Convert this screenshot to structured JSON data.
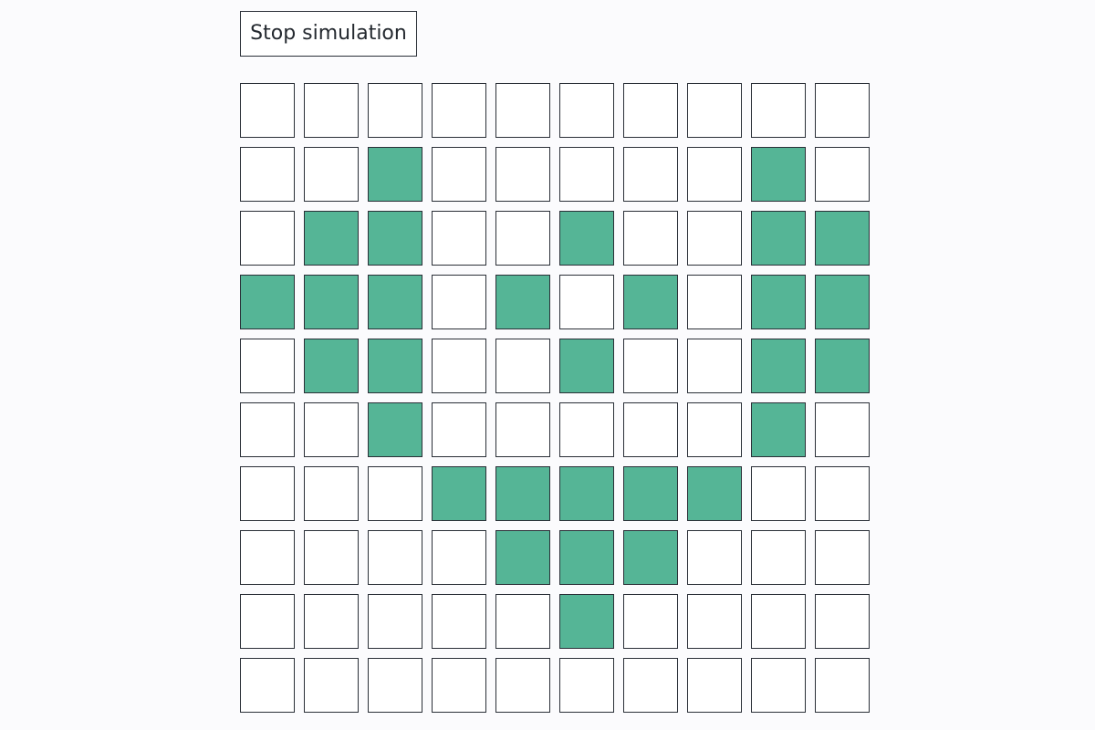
{
  "controls": {
    "stop_label": "Stop simulation"
  },
  "colors": {
    "alive": "#55b596",
    "dead": "#ffffff",
    "border": "#2a2f37"
  },
  "grid": {
    "rows": 10,
    "cols": 10,
    "cells": [
      [
        0,
        0,
        0,
        0,
        0,
        0,
        0,
        0,
        0,
        0
      ],
      [
        0,
        0,
        1,
        0,
        0,
        0,
        0,
        0,
        1,
        0
      ],
      [
        0,
        1,
        1,
        0,
        0,
        1,
        0,
        0,
        1,
        1
      ],
      [
        1,
        1,
        1,
        0,
        1,
        0,
        1,
        0,
        1,
        1
      ],
      [
        0,
        1,
        1,
        0,
        0,
        1,
        0,
        0,
        1,
        1
      ],
      [
        0,
        0,
        1,
        0,
        0,
        0,
        0,
        0,
        1,
        0
      ],
      [
        0,
        0,
        0,
        1,
        1,
        1,
        1,
        1,
        0,
        0
      ],
      [
        0,
        0,
        0,
        0,
        1,
        1,
        1,
        0,
        0,
        0
      ],
      [
        0,
        0,
        0,
        0,
        0,
        1,
        0,
        0,
        0,
        0
      ],
      [
        0,
        0,
        0,
        0,
        0,
        0,
        0,
        0,
        0,
        0
      ]
    ]
  }
}
